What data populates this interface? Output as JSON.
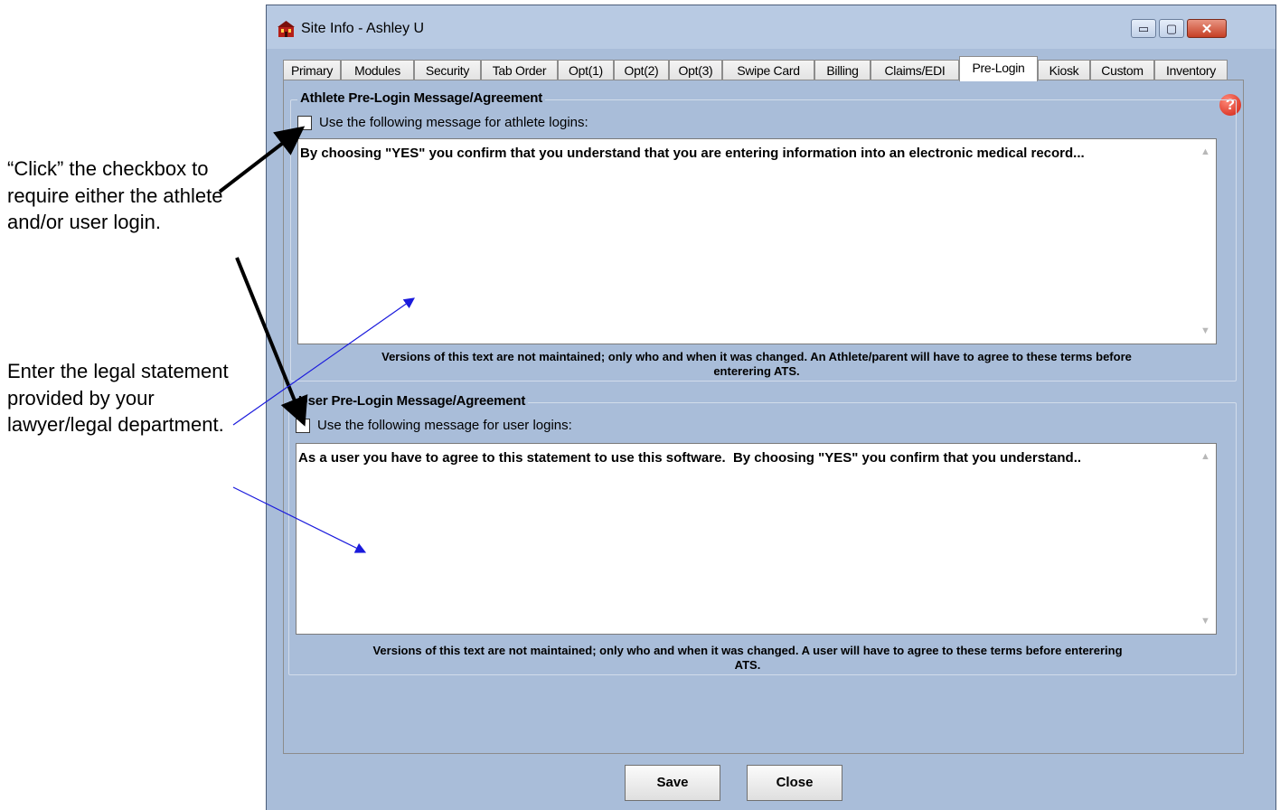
{
  "annotations": {
    "checkbox_note": "“Click” the checkbox to require either the athlete and/or user login.",
    "legal_note": "Enter the legal statement provided by your lawyer/legal department."
  },
  "window": {
    "title": "Site Info - Ashley U",
    "controls": {
      "minimize": "▭",
      "maximize": "▢",
      "close": "✕"
    }
  },
  "tabs": [
    {
      "label": "Primary"
    },
    {
      "label": "Modules"
    },
    {
      "label": "Security"
    },
    {
      "label": "Tab Order"
    },
    {
      "label": "Opt(1)"
    },
    {
      "label": "Opt(2)"
    },
    {
      "label": "Opt(3)"
    },
    {
      "label": "Swipe Card"
    },
    {
      "label": "Billing"
    },
    {
      "label": "Claims/EDI"
    },
    {
      "label": "Pre-Login",
      "active": true
    },
    {
      "label": "Kiosk"
    },
    {
      "label": "Custom"
    },
    {
      "label": "Inventory"
    }
  ],
  "athlete": {
    "title": "Athlete Pre-Login Message/Agreement",
    "checkbox_label": "Use the following message for athlete logins:",
    "checked": false,
    "message": "By choosing \"YES\" you confirm that you understand that you are entering information into an electronic medical record...",
    "note": "Versions of this text are not maintained; only who and when it was changed. An Athlete/parent will have to agree to these terms before enterering ATS."
  },
  "user": {
    "title": "User Pre-Login Message/Agreement",
    "checkbox_label": "Use the following message for user logins:",
    "checked": false,
    "message": "As a user you have to agree to this statement to use this software.  By choosing \"YES\" you confirm that you understand..",
    "note": "Versions of this text are not maintained; only who and when it was changed.   A user will have to agree to these terms before enterering ATS."
  },
  "help_icon": "?",
  "buttons": {
    "save": "Save",
    "close": "Close"
  }
}
